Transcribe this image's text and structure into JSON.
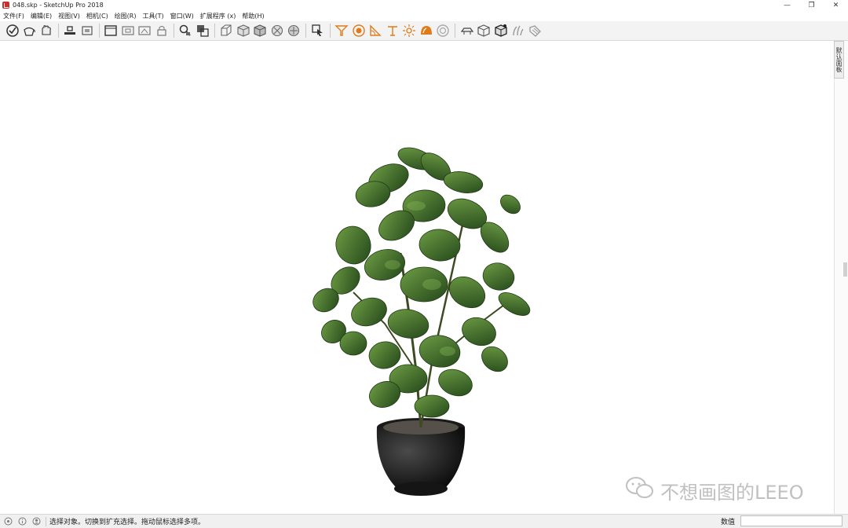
{
  "window": {
    "title": "048.skp - SketchUp Pro 2018",
    "controls": {
      "minimize": "—",
      "restore": "❐",
      "close": "✕"
    }
  },
  "menu": [
    {
      "label": "文件(F)"
    },
    {
      "label": "编辑(E)"
    },
    {
      "label": "视图(V)"
    },
    {
      "label": "相机(C)"
    },
    {
      "label": "绘图(R)"
    },
    {
      "label": "工具(T)"
    },
    {
      "label": "窗口(W)"
    },
    {
      "label": "扩展程序 (x)"
    },
    {
      "label": "帮助(H)"
    }
  ],
  "toolbar": {
    "groups": [
      [
        "select-icon",
        "paint-bucket-icon",
        "orbit-hand-icon"
      ],
      [
        "component-icon",
        "section-icon"
      ],
      [
        "window-frame-icon",
        "camera-view-icon",
        "scene-icon",
        "lock-icon"
      ],
      [
        "magnify-icon",
        "style-icon"
      ],
      [
        "iso-view-icon",
        "top-view-icon",
        "front-view-icon",
        "xray-icon",
        "wireframe-icon"
      ],
      [
        "select-tool-icon"
      ],
      [
        "funnel-icon",
        "target-icon",
        "protractor-icon",
        "shade-icon",
        "sun-icon",
        "dome-icon",
        "circle-icon"
      ],
      [
        "hat-icon",
        "cube-icon",
        "cube-paint-icon",
        "grass-icon",
        "tag-icon"
      ]
    ]
  },
  "tray": {
    "tab_label": "默认面板"
  },
  "watermark": {
    "text": "不想画图的LEEO"
  },
  "status": {
    "message": "选择对象。切换到扩充选择。拖动鼠标选择多项。",
    "measurements_label": "数值",
    "measurements_value": ""
  },
  "colors": {
    "accent_orange": "#e07b1a",
    "leaf_dark": "#2f5a1e",
    "leaf_light": "#5a8a35",
    "pot": "#232323"
  }
}
